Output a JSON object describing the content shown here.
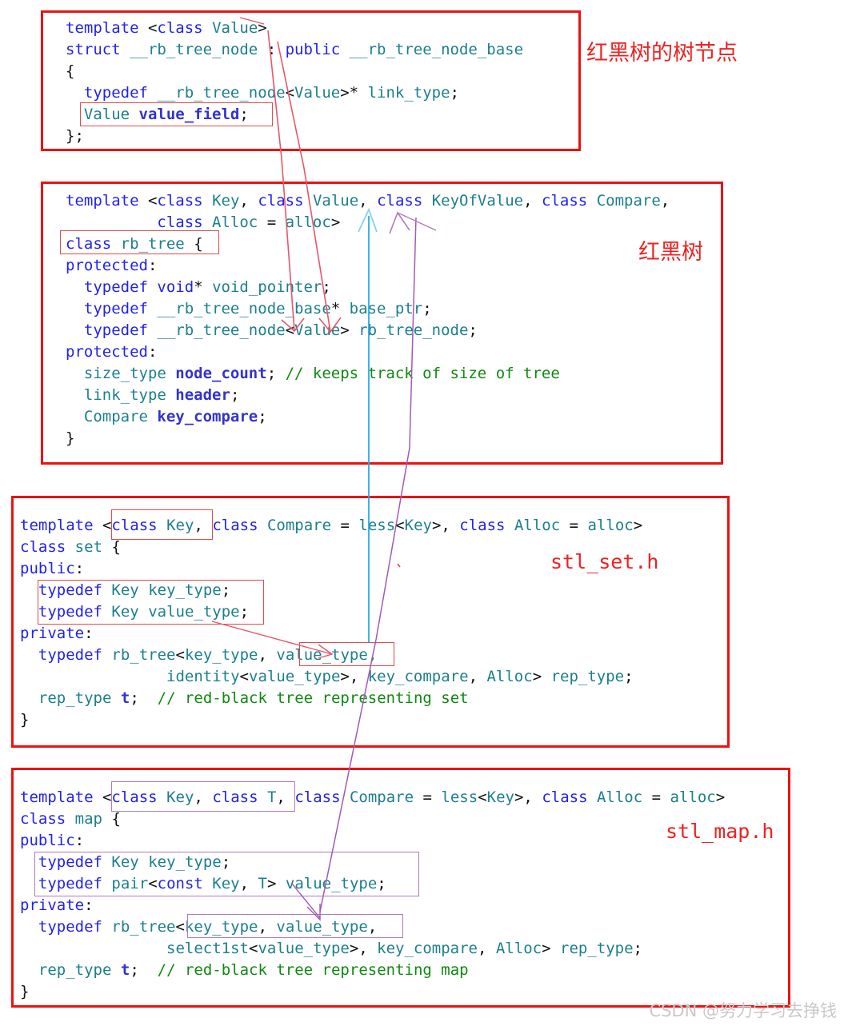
{
  "page": {
    "watermark": "CSDN @努力学习去挣钱",
    "accent_red": "#ee1111",
    "keyword_blue": "#2222ee",
    "identifier_teal": "#1c7f8c",
    "comment_green": "#118811",
    "highlight_purple": "#b07ac0"
  },
  "blocks": [
    {
      "id": "rb-tree-node",
      "annotation": "红黑树的树节点",
      "lines": [
        "template <class Value>",
        "struct __rb_tree_node : public __rb_tree_node_base",
        "{",
        "  typedef __rb_tree_node<Value>* link_type;",
        "  Value value_field;",
        "};"
      ]
    },
    {
      "id": "rb-tree",
      "annotation": "红黑树",
      "lines": [
        "template <class Key, class Value, class KeyOfValue, class Compare,",
        "          class Alloc = alloc>",
        "class rb_tree {",
        "protected:",
        "  typedef void* void_pointer;",
        "  typedef __rb_tree_node_base* base_ptr;",
        "  typedef __rb_tree_node<Value> rb_tree_node;",
        "protected:",
        "  size_type node_count; // keeps track of size of tree",
        "  link_type header;",
        "  Compare key_compare;",
        "}"
      ]
    },
    {
      "id": "stl-set",
      "annotation": "stl_set.h",
      "lines": [
        "template <class Key, class Compare = less<Key>, class Alloc = alloc>",
        "class set {",
        "public:",
        "  typedef Key key_type;",
        "  typedef Key value_type;",
        "private:",
        "  typedef rb_tree<key_type, value_type,",
        "                identity<value_type>, key_compare, Alloc> rep_type;",
        "  rep_type t;  // red-black tree representing set",
        "}"
      ]
    },
    {
      "id": "stl-map",
      "annotation": "stl_map.h",
      "lines": [
        "template <class Key, class T, class Compare = less<Key>, class Alloc = alloc>",
        "class map {",
        "public:",
        "  typedef Key key_type;",
        "  typedef pair<const Key, T> value_type;",
        "private:",
        "  typedef rb_tree<key_type, value_type,",
        "                select1st<value_type>, key_compare, Alloc> rep_type;",
        "  rep_type t;  // red-black tree representing map",
        "}"
      ]
    }
  ],
  "annotations": {
    "node_label": "红黑树的树节点",
    "tree_label": "红黑树",
    "set_file": "stl_set.h",
    "map_file": "stl_map.h"
  },
  "highlights": [
    {
      "name": "value-field",
      "text": "Value value_field;",
      "color": "red"
    },
    {
      "name": "class-rb-tree",
      "text": "class rb_tree {",
      "color": "red"
    },
    {
      "name": "set-class-key",
      "text": "<class Key,",
      "color": "red"
    },
    {
      "name": "set-typedefs",
      "text": "typedef Key key_type; typedef Key value_type;",
      "color": "red"
    },
    {
      "name": "set-value-type",
      "text": "value_type,",
      "color": "red"
    },
    {
      "name": "map-class-key-t",
      "text": "<class Key, class T,",
      "color": "purple"
    },
    {
      "name": "map-typedefs",
      "text": "typedef Key key_type; typedef pair<const Key, T> value_type;",
      "color": "purple"
    },
    {
      "name": "map-key-value-type",
      "text": "<key_type, value_type,",
      "color": "purple"
    }
  ]
}
